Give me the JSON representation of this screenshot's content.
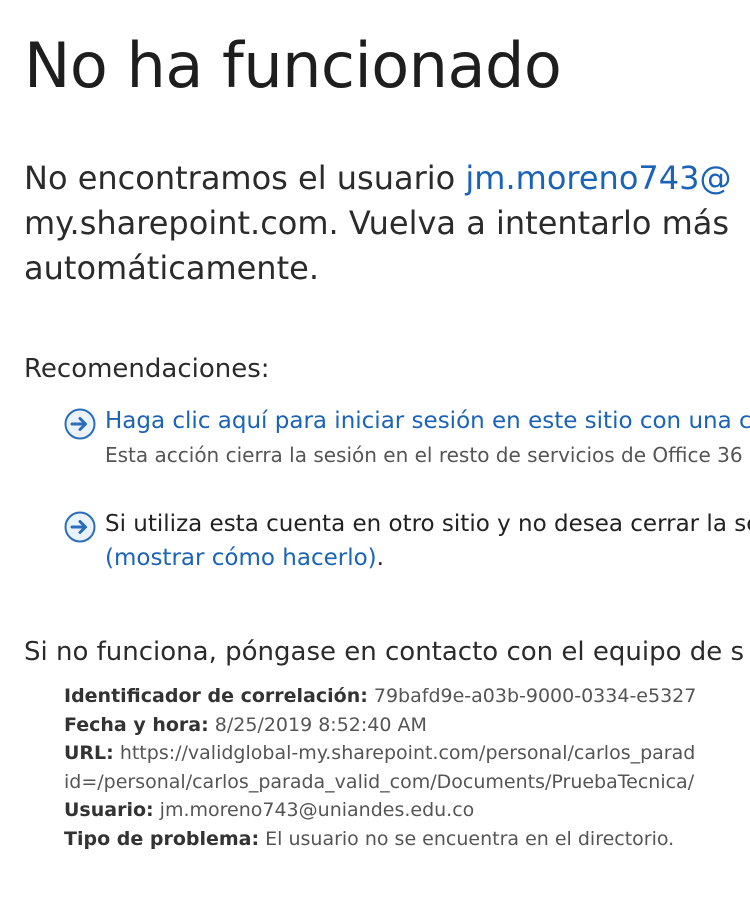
{
  "title": "No ha funcionado",
  "message": {
    "prefix": "No encontramos el usuario ",
    "user_link": "jm.moreno743@",
    "line2": "my.sharepoint.com. Vuelva a intentarlo más",
    "line3": "automáticamente."
  },
  "recommendations": {
    "heading": "Recomendaciones:",
    "items": [
      {
        "icon": "arrow-circle-right-icon",
        "link": "Haga clic aquí para iniciar sesión en este sitio con una cu",
        "sub": "Esta acción cierra la sesión en el resto de servicios de Office 36"
      },
      {
        "icon": "arrow-circle-right-icon",
        "text": "Si utiliza esta cuenta en otro sitio y no desea cerrar la se",
        "link": "(mostrar cómo hacerlo)",
        "suffix": "."
      }
    ]
  },
  "contact": "Si no funciona, póngase en contacto con el equipo de s",
  "details": {
    "correlation_label": "Identificador de correlación:",
    "correlation_value": "79bafd9e-a03b-9000-0334-e5327",
    "datetime_label": "Fecha y hora:",
    "datetime_value": "8/25/2019 8:52:40 AM",
    "url_label": "URL:",
    "url_value": "https://validglobal-my.sharepoint.com/personal/carlos_parad",
    "url_value_cont": "id=/personal/carlos_parada_valid_com/Documents/PruebaTecnica/",
    "user_label": "Usuario:",
    "user_value": "jm.moreno743@uniandes.edu.co",
    "problem_label": "Tipo de problema:",
    "problem_value": "El usuario no se encuentra en el directorio."
  },
  "colors": {
    "link": "#1a63b8",
    "icon_blue": "#2a6ebb"
  }
}
